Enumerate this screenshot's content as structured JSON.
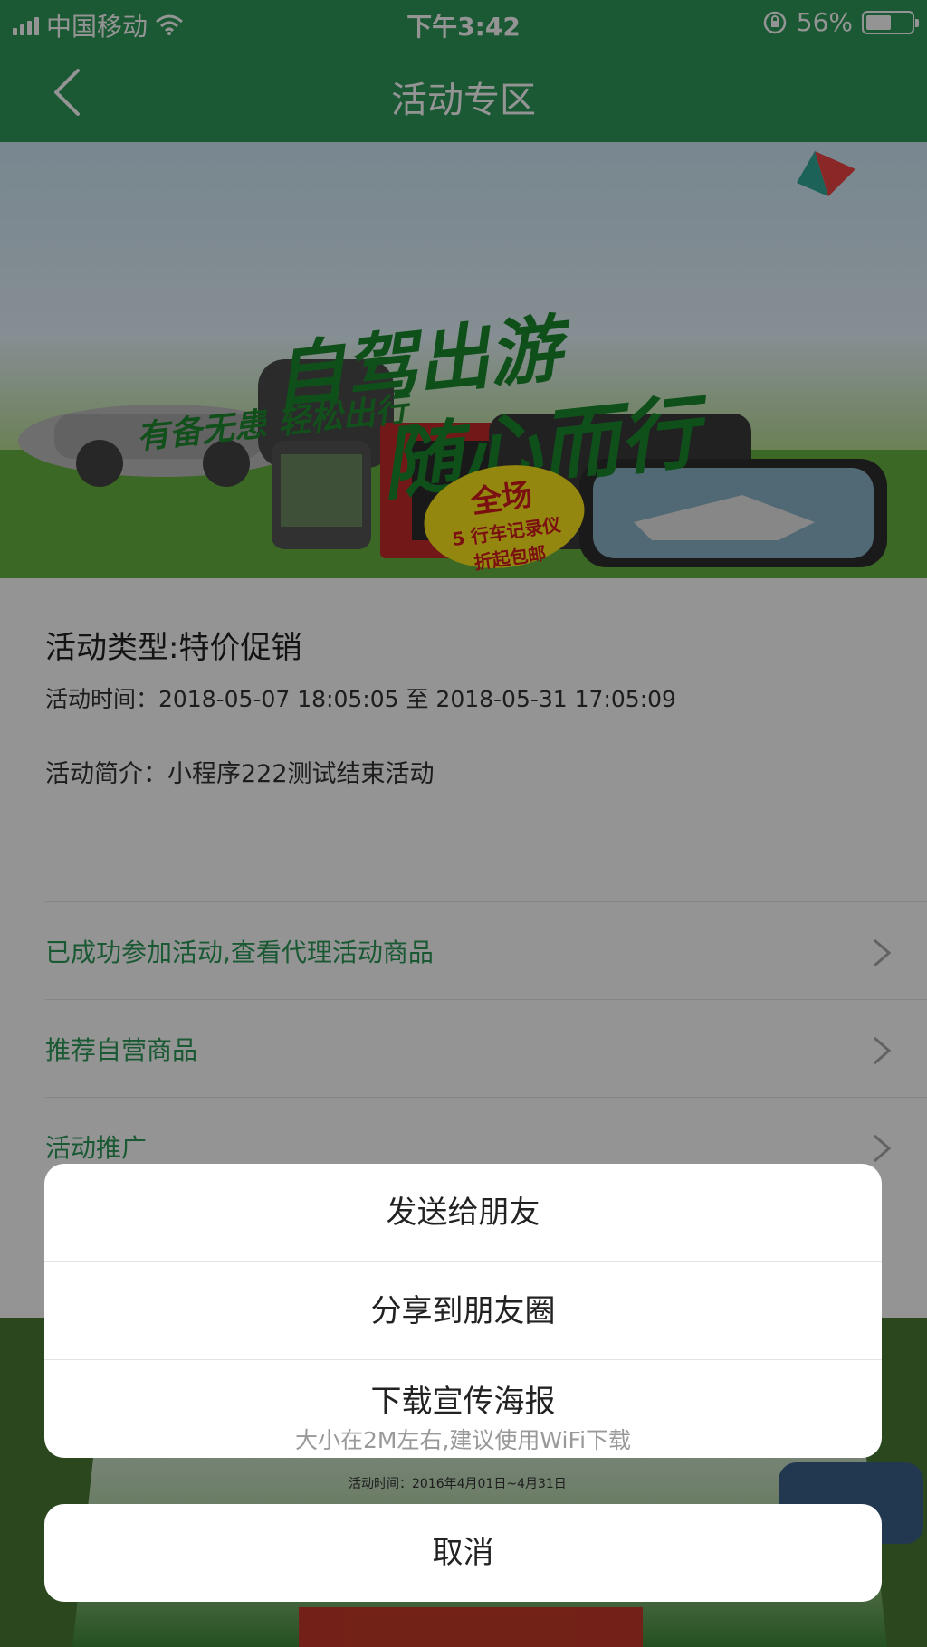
{
  "status": {
    "carrier": "中国移动",
    "time": "下午3:42",
    "battery": "56%",
    "battery_level": 0.56
  },
  "nav": {
    "title": "活动专区"
  },
  "banner": {
    "headline1": "自驾出游",
    "headline2": "随心而行",
    "tagline": "有备无患 轻松出行",
    "badge_line1": "全场",
    "badge_line2": "5 行车记录仪",
    "badge_line3": "折起包邮"
  },
  "activity": {
    "type": "活动类型:特价促销",
    "time": "活动时间：2018-05-07 18:05:05 至 2018-05-31 17:05:09",
    "intro": "活动简介：小程序222测试结束活动"
  },
  "list": [
    {
      "label": "已成功参加活动,查看代理活动商品"
    },
    {
      "label": "推荐自营商品"
    },
    {
      "label": "活动推广"
    }
  ],
  "lower_banner": {
    "small_text": "活动时间：2016年4月01日~4月31日"
  },
  "sheet": {
    "send_friend": "发送给朋友",
    "share_moments": "分享到朋友圈",
    "download_poster": "下载宣传海报",
    "download_hint": "大小在2M左右,建议使用WiFi下载",
    "cancel": "取消"
  },
  "colors": {
    "accent": "#2e9a5a",
    "overlay": "rgba(0,0,0,0.42)"
  }
}
